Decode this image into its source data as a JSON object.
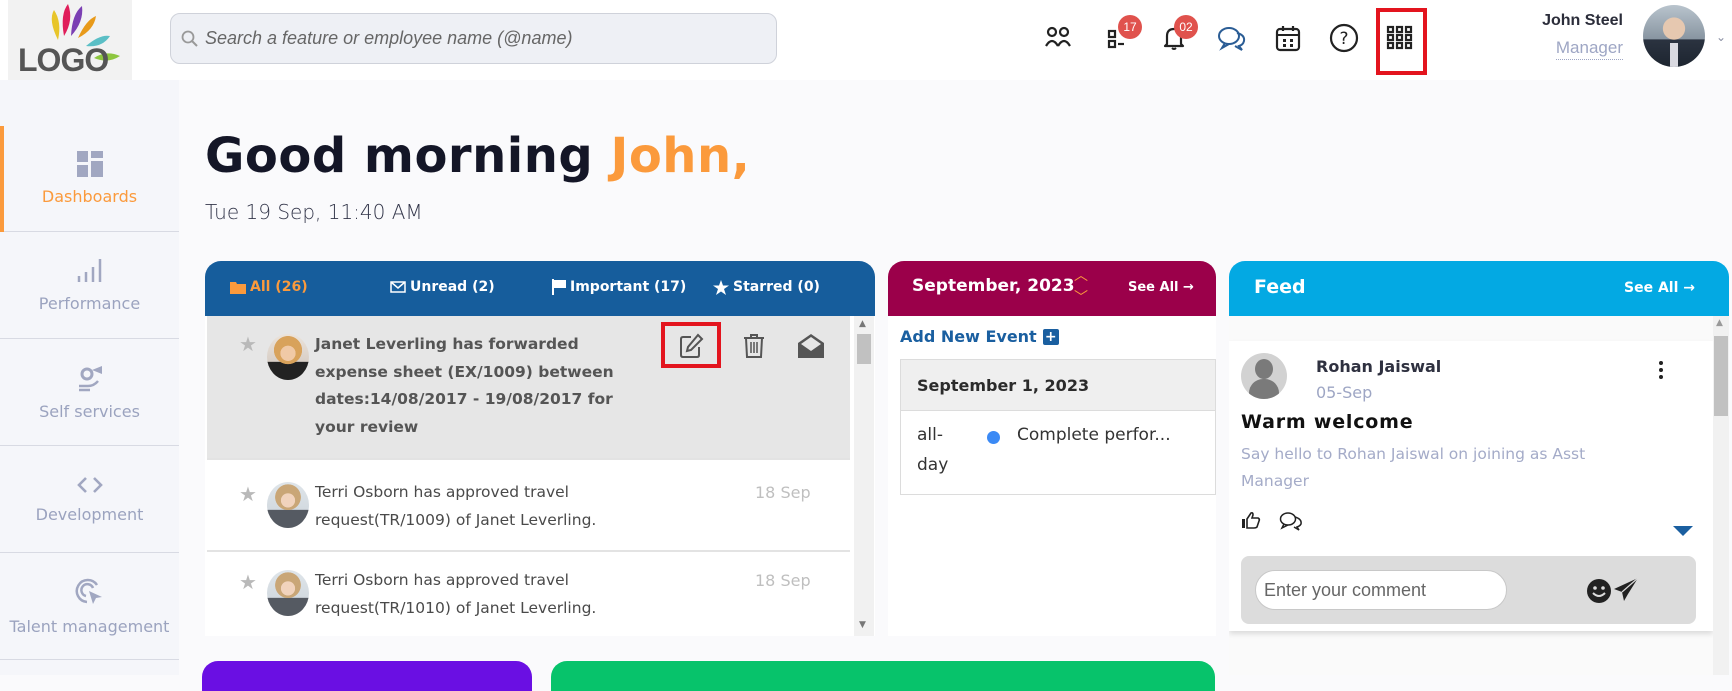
{
  "header": {
    "logo_text": "LOGO",
    "search_placeholder": "Search a feature or employee name (@name)",
    "icons": [
      {
        "name": "people-icon"
      },
      {
        "name": "tasks-icon",
        "badge": "17"
      },
      {
        "name": "bell-icon",
        "badge": "02"
      },
      {
        "name": "chat-icon"
      },
      {
        "name": "calendar-icon"
      },
      {
        "name": "help-icon"
      },
      {
        "name": "apps-grid-icon"
      }
    ],
    "user": {
      "name": "John Steel",
      "role": "Manager"
    }
  },
  "sidebar": {
    "items": [
      {
        "label": "Dashboards",
        "icon": "dashboard-icon",
        "active": true
      },
      {
        "label": "Performance",
        "icon": "bar-chart-icon"
      },
      {
        "label": "Self services",
        "icon": "self-service-icon"
      },
      {
        "label": "Development",
        "icon": "code-icon"
      },
      {
        "label": "Talent management",
        "icon": "target-cursor-icon"
      }
    ]
  },
  "greeting": {
    "prefix": "Good morning ",
    "name": "John,",
    "datetime": "Tue 19 Sep, 11:40 AM"
  },
  "messages": {
    "tabs": [
      {
        "label": "All (26)",
        "icon": "folder-icon",
        "active": true
      },
      {
        "label": "Unread (2)",
        "icon": "envelope-icon"
      },
      {
        "label": "Important (17)",
        "icon": "flag-icon"
      },
      {
        "label": "Starred (0)",
        "icon": "star-icon"
      }
    ],
    "items": [
      {
        "text": "Janet Leverling has forwarded expense sheet (EX/1009) between dates:14/08/2017 - 19/08/2017 for your review",
        "date": "",
        "selected": true
      },
      {
        "text": "Terri Osborn has approved travel request(TR/1009) of Janet Leverling.",
        "date": "18 Sep"
      },
      {
        "text": "Terri Osborn has approved travel request(TR/1010) of Janet Leverling.",
        "date": "18 Sep"
      }
    ]
  },
  "calendar": {
    "month": "September, 2023",
    "see_all": "See All →",
    "add_event": "Add New Event",
    "day_heading": "September 1, 2023",
    "events": [
      {
        "time": "all-day",
        "title": "Complete perfor...",
        "color": "#3b8af5"
      }
    ]
  },
  "feed": {
    "title": "Feed",
    "see_all": "See All →",
    "post": {
      "author": "Rohan Jaiswal",
      "date": "05-Sep",
      "title": "Warm welcome",
      "body": "Say hello to Rohan Jaiswal on joining as Asst Manager"
    },
    "comment_placeholder": "Enter your comment"
  },
  "colors": {
    "accent": "#fb9a3c",
    "messages_header": "#165d9c",
    "calendar_header": "#9b004a",
    "feed_header": "#03a9e3",
    "badge": "#e0524d",
    "highlight": "#e3141e"
  }
}
